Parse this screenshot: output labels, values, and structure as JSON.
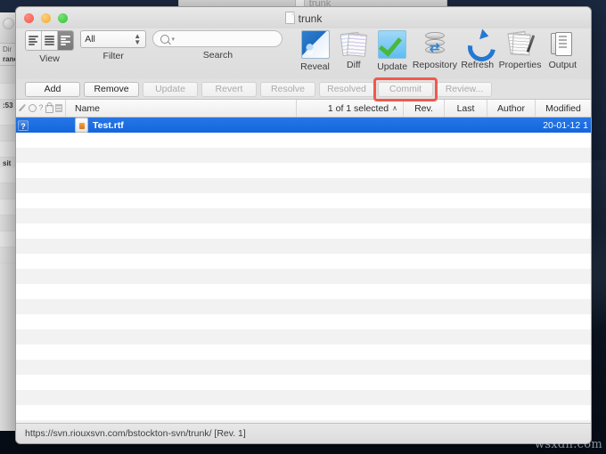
{
  "window": {
    "title": "trunk",
    "peek_title": "trunk"
  },
  "traffic_lights": {
    "close": "close",
    "minimize": "minimize",
    "zoom": "zoom"
  },
  "toolbar": {
    "groups": [
      {
        "caption": "View"
      },
      {
        "caption": "Filter"
      },
      {
        "caption": "Search"
      },
      {
        "caption": "Reveal"
      },
      {
        "caption": "Diff"
      },
      {
        "caption": "Update"
      },
      {
        "caption": "Repository"
      },
      {
        "caption": "Refresh"
      },
      {
        "caption": "Properties"
      },
      {
        "caption": "Output"
      }
    ],
    "filter": {
      "value": "All"
    },
    "search": {
      "value": "",
      "placeholder": ""
    }
  },
  "action_buttons": [
    {
      "label": "Add",
      "disabled": false
    },
    {
      "label": "Remove",
      "disabled": false
    },
    {
      "label": "Update",
      "disabled": true
    },
    {
      "label": "Revert",
      "disabled": true
    },
    {
      "label": "Resolve",
      "disabled": true
    },
    {
      "label": "Resolved",
      "disabled": true
    },
    {
      "label": "Commit",
      "disabled": true
    },
    {
      "label": "Review...",
      "disabled": true
    }
  ],
  "highlight": {
    "target": "Commit",
    "color": "#f0594b"
  },
  "columns": {
    "flags": [
      "pencil-icon",
      "conflict-icon",
      "unknown-icon",
      "lock-icon",
      "list-icon"
    ],
    "name": "Name",
    "selection": "1 of 1 selected",
    "sort_caret": "∧",
    "rev": "Rev.",
    "last": "Last",
    "author": "Author",
    "modified": "Modified"
  },
  "file_rows": [
    {
      "status": "?",
      "icon": "rtf-file-icon",
      "name": "Test.rtf",
      "rev": "",
      "last": "",
      "author": "",
      "modified": "20-01-12 1",
      "selected": true
    }
  ],
  "empty_row_count": 20,
  "statusbar": {
    "text": "https://svn.riouxsvn.com/bstockton-svn/trunk/  [Rev. 1]"
  },
  "background_window": {
    "fragments": [
      "Dir",
      "ranc",
      ":53",
      "sit"
    ]
  },
  "watermark": {
    "text": "wsxdn.com"
  },
  "colors": {
    "selection_blue": "#1566dd",
    "highlight_red": "#f0594b",
    "window_chrome": "#ececec",
    "desktop": "#0d1726"
  }
}
